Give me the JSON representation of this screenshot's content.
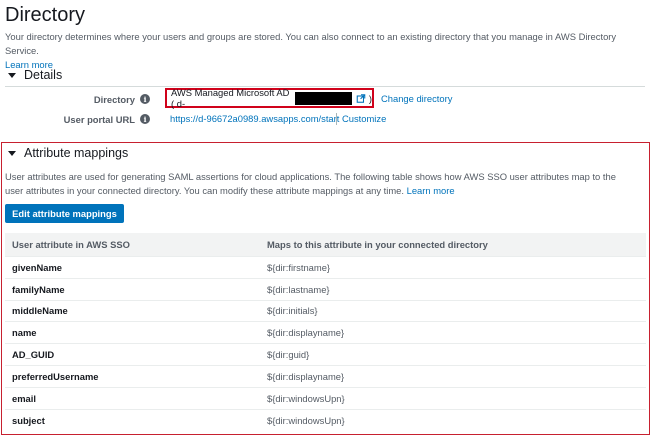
{
  "page": {
    "title": "Directory",
    "intro": "Your directory determines where your users and groups are stored. You can also connect to an existing directory that you manage in AWS Directory Service.",
    "learn_more": "Learn more"
  },
  "details": {
    "header": "Details",
    "directory_label": "Directory",
    "directory_value": "AWS Managed Microsoft AD ( d-",
    "directory_value_close": ")",
    "change_directory": "Change directory",
    "portal_label": "User portal URL",
    "portal_url": "https://d-96672a0989.awsapps.com/start",
    "customize": "Customize"
  },
  "attribute_mappings": {
    "header": "Attribute mappings",
    "description": "User attributes are used for generating SAML assertions for cloud applications. The following table shows how AWS SSO user attributes map to the user attributes in your connected directory. You can modify these attribute mappings at any time.",
    "learn_more": "Learn more",
    "edit_button": "Edit attribute mappings",
    "columns": [
      "User attribute in AWS SSO",
      "Maps to this attribute in your connected directory"
    ],
    "rows": [
      [
        "givenName",
        "${dir:firstname}"
      ],
      [
        "familyName",
        "${dir:lastname}"
      ],
      [
        "middleName",
        "${dir:initials}"
      ],
      [
        "name",
        "${dir:displayname}"
      ],
      [
        "AD_GUID",
        "${dir:guid}"
      ],
      [
        "preferredUsername",
        "${dir:displayname}"
      ],
      [
        "email",
        "${dir:windowsUpn}"
      ],
      [
        "subject",
        "${dir:windowsUpn}"
      ]
    ]
  },
  "icons": {
    "info": "info-icon",
    "external": "external-link-icon",
    "caret": "caret-down-icon"
  },
  "colors": {
    "link": "#0073bb",
    "primary_button": "#0073bb",
    "highlight_border": "#c7202f"
  }
}
